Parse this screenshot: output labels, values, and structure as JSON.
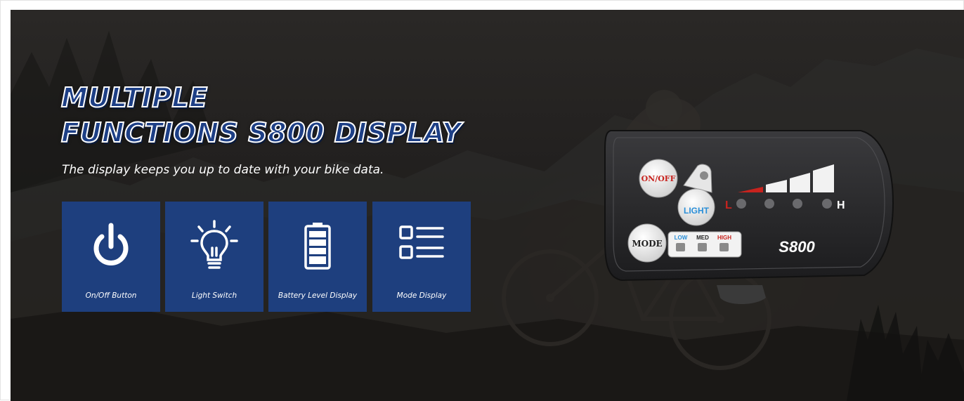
{
  "headline": {
    "line1": "MULTIPLE",
    "line2": "FUNCTIONS S800 DISPLAY"
  },
  "subtitle": "The display keeps you up to date with your bike data.",
  "features": [
    {
      "icon": "power-icon",
      "label": "On/Off Button"
    },
    {
      "icon": "lightbulb-icon",
      "label": "Light Switch"
    },
    {
      "icon": "battery-icon",
      "label": "Battery Level Display"
    },
    {
      "icon": "list-icon",
      "label": "Mode Display"
    }
  ],
  "device": {
    "onoff_label": "ON/OFF",
    "light_label": "LIGHT",
    "mode_label": "MODE",
    "level_low": "L",
    "level_high": "H",
    "mode_low": "LOW",
    "mode_med": "MED",
    "mode_high": "HIGH",
    "model": "S800"
  },
  "colors": {
    "tile": "#1e3f7e",
    "headline_fill": "#1d3f86",
    "device_body": "#2b2b2d",
    "accent_red": "#d42a2a",
    "accent_blue": "#2a8fd8"
  }
}
